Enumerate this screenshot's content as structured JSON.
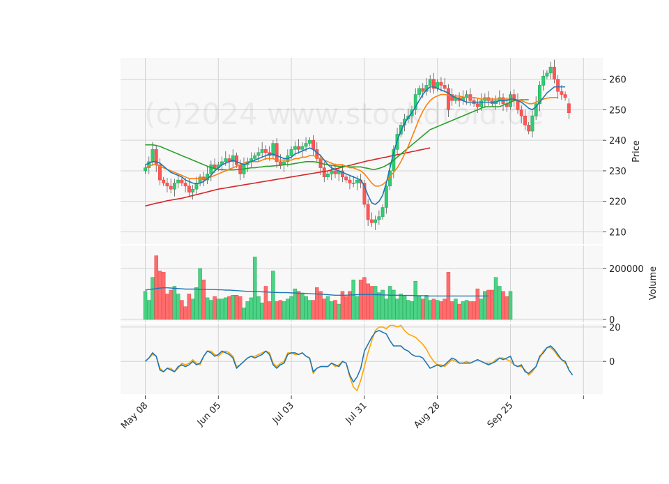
{
  "watermark": "(c)2024 www.stockdroid.de",
  "colors": {
    "panel_bg": "#f8f8f8",
    "grid": "#d3d3d3",
    "up": "#26a65b",
    "up_fill": "#2ecc71",
    "down": "#ee4444",
    "down_fill": "#ff5555",
    "ma_fast": "#1f77b4",
    "ma_mid": "#ff7f0e",
    "ma_slow": "#2ca02c",
    "ma_long": "#d62728",
    "vol_ma": "#1f77b4",
    "osc_1": "#1f77b4",
    "osc_2": "#ffa500",
    "axis_text": "#222222"
  },
  "chart_data": [
    {
      "type": "candlestick",
      "panel": "price",
      "ylabel": "Price",
      "ylim": [
        206,
        267
      ],
      "yticks": [
        210,
        220,
        230,
        240,
        250,
        260
      ],
      "x_ticks": [
        {
          "label": "May 08",
          "index": 0
        },
        {
          "label": "Jun 05",
          "index": 20
        },
        {
          "label": "Jul 03",
          "index": 40
        },
        {
          "label": "Jul 31",
          "index": 60
        },
        {
          "label": "Aug 28",
          "index": 80
        },
        {
          "label": "Sep 25",
          "index": 100
        },
        {
          "label": "",
          "index": 120
        }
      ],
      "close": [
        231,
        233,
        237,
        232,
        227,
        226,
        225,
        224,
        226,
        227,
        226,
        225,
        223,
        224,
        226,
        228,
        227,
        229,
        232,
        231,
        232,
        233,
        234,
        233,
        235,
        232,
        229,
        232,
        233,
        234,
        235,
        236,
        237,
        236,
        235,
        239,
        233,
        232,
        233,
        235,
        237,
        238,
        237,
        238,
        239,
        240,
        237,
        234,
        231,
        228,
        229,
        230,
        229,
        230,
        228,
        227,
        226,
        226,
        227,
        226,
        219,
        214,
        213,
        214,
        215,
        218,
        225,
        230,
        237,
        242,
        245,
        247,
        248,
        250,
        255,
        257,
        256,
        258,
        260,
        257,
        259,
        258,
        257,
        250,
        253,
        254,
        253,
        254,
        255,
        253,
        252,
        251,
        253,
        254,
        253,
        252,
        253,
        254,
        252,
        251,
        255,
        253,
        250,
        248,
        245,
        243,
        248,
        252,
        258,
        261,
        262,
        264,
        260,
        256,
        255,
        254,
        249
      ],
      "open": [
        230,
        231,
        233,
        237,
        232,
        227,
        226,
        225,
        224,
        226,
        227,
        226,
        225,
        223,
        224,
        226,
        228,
        227,
        229,
        232,
        231,
        232,
        233,
        234,
        233,
        235,
        232,
        229,
        232,
        233,
        234,
        235,
        236,
        237,
        236,
        235,
        239,
        233,
        232,
        233,
        235,
        237,
        238,
        237,
        238,
        239,
        240,
        237,
        234,
        231,
        228,
        229,
        230,
        229,
        230,
        228,
        227,
        226,
        226,
        227,
        226,
        219,
        214,
        213,
        214,
        215,
        218,
        225,
        230,
        237,
        242,
        245,
        247,
        248,
        250,
        255,
        257,
        256,
        258,
        260,
        257,
        259,
        258,
        257,
        255,
        253,
        254,
        253,
        254,
        255,
        253,
        252,
        251,
        253,
        254,
        253,
        252,
        253,
        254,
        252,
        251,
        255,
        253,
        250,
        248,
        245,
        243,
        248,
        252,
        258,
        261,
        262,
        264,
        260,
        256,
        255,
        252
      ],
      "ma_fast": [
        232,
        232.5,
        233,
        233,
        232.5,
        231.5,
        230.5,
        229.5,
        229,
        228.5,
        228,
        227,
        226.5,
        226,
        225.8,
        226,
        226.5,
        227.5,
        228.5,
        230,
        231,
        232,
        232.5,
        233,
        233.5,
        233,
        232.5,
        232,
        232.5,
        233,
        233.5,
        234,
        234.5,
        235,
        235.5,
        235.5,
        235,
        234.5,
        234,
        234,
        234.5,
        235.5,
        236,
        236.5,
        237,
        237.5,
        237,
        236,
        235,
        233.5,
        232,
        231,
        230.5,
        230,
        229.5,
        229,
        228.5,
        228,
        227.5,
        227,
        225,
        222,
        219.5,
        219,
        220,
        222,
        226,
        231,
        236,
        240,
        243,
        245.5,
        247.5,
        249,
        251,
        253,
        255,
        256.5,
        257.5,
        257.5,
        257,
        256.5,
        256,
        255.5,
        254.5,
        254,
        253.5,
        253,
        252.5,
        252.5,
        252.5,
        252.5,
        252.5,
        252.5,
        252.5,
        252.5,
        252.5,
        253,
        253,
        253,
        253.5,
        253.5,
        253,
        252.5,
        251.5,
        250.5,
        250,
        251,
        252.5,
        254,
        255.5,
        256.5,
        257.5,
        257.5,
        257.5,
        257.5
      ],
      "ma_mid": [
        231,
        231.5,
        232,
        232,
        231.5,
        231,
        230.5,
        230,
        229.5,
        229,
        228.5,
        228,
        227.5,
        227.5,
        227.5,
        227.5,
        227.5,
        227.7,
        228,
        228.5,
        229,
        229.5,
        230,
        230.5,
        231,
        231.5,
        232,
        232.5,
        233,
        233,
        233,
        233,
        233.5,
        234,
        234,
        234,
        233.5,
        233.5,
        233.5,
        233.5,
        233.5,
        234,
        234,
        234.5,
        234.5,
        235,
        235,
        234.5,
        234,
        233.5,
        233,
        232.5,
        232,
        232,
        232,
        231.5,
        231,
        231,
        230.5,
        230,
        229,
        227.5,
        226,
        225,
        225,
        225.5,
        226.5,
        228,
        229.5,
        231,
        233,
        235.5,
        238,
        241,
        244,
        247,
        249.5,
        251.5,
        253,
        254,
        254.5,
        255,
        255,
        254.8,
        254.5,
        254.5,
        254.5,
        254.2,
        254,
        254,
        254,
        253.8,
        253.5,
        253.5,
        253.5,
        253.5,
        253.5,
        253.5,
        253.5,
        253.5,
        253.5,
        253.5,
        253.3,
        253,
        252.5,
        252,
        252,
        252.5,
        253,
        253.5,
        253.8,
        254,
        254,
        254
      ],
      "ma_slow": [
        238.5,
        238.5,
        238.5,
        238.3,
        238,
        237.5,
        237,
        236.5,
        236,
        235.5,
        235,
        234.5,
        234,
        233.5,
        233,
        232.5,
        232,
        231.5,
        231,
        230.8,
        230.5,
        230.4,
        230.3,
        230.3,
        230.3,
        230.4,
        230.5,
        230.6,
        230.8,
        231,
        231,
        231.2,
        231.3,
        231.5,
        231.5,
        231.6,
        231.7,
        231.8,
        232,
        232,
        232.2,
        232.4,
        232.6,
        232.8,
        233,
        233,
        233,
        232.8,
        232.5,
        232.2,
        232,
        231.8,
        231.6,
        231.5,
        231.5,
        231.4,
        231.3,
        231.3,
        231.3,
        231.3,
        231,
        230.8,
        230.5,
        230.5,
        230.8,
        231.2,
        231.8,
        232.5,
        233.5,
        234.5,
        235.5,
        236.5,
        237.5,
        238.5,
        239.5,
        240.5,
        241.5,
        242.5,
        243.5,
        244,
        244.5,
        245,
        245.5,
        246,
        246.5,
        247,
        247.5,
        248,
        248.5,
        249,
        249.5,
        250,
        250.5,
        251,
        251,
        251,
        251,
        251,
        251.5,
        252,
        252.5,
        253,
        253.2,
        253.3,
        253.3,
        253.3
      ],
      "ma_long": [
        218.5,
        218.8,
        219.1,
        219.4,
        219.6,
        219.9,
        220.2,
        220.4,
        220.6,
        220.8,
        221,
        221.3,
        221.6,
        221.9,
        222.2,
        222.5,
        222.8,
        223.1,
        223.4,
        223.7,
        224,
        224.2,
        224.4,
        224.6,
        224.8,
        225,
        225.2,
        225.4,
        225.6,
        225.8,
        226,
        226.2,
        226.4,
        226.6,
        226.8,
        227,
        227.2,
        227.4,
        227.6,
        227.8,
        228,
        228.2,
        228.4,
        228.6,
        228.8,
        229,
        229.2,
        229.4,
        229.6,
        229.8,
        230,
        230.3,
        230.6,
        230.9,
        231.2,
        231.5,
        231.8,
        232.1,
        232.4,
        232.7,
        233,
        233.3,
        233.5,
        233.8,
        234,
        234.3,
        234.5,
        234.8,
        235,
        235.3,
        235.5,
        235.8,
        236,
        236.3,
        236.5,
        236.8,
        237,
        237.3,
        237.5
      ]
    },
    {
      "type": "bar",
      "panel": "volume",
      "ylabel": "Volume",
      "ylim": [
        0,
        290000
      ],
      "yticks": [
        0,
        200000
      ],
      "ytick_labels": [
        "0",
        "200000"
      ],
      "values": [
        110000,
        75000,
        165000,
        250000,
        190000,
        185000,
        100000,
        115000,
        130000,
        100000,
        75000,
        50000,
        100000,
        80000,
        125000,
        200000,
        155000,
        85000,
        75000,
        90000,
        80000,
        80000,
        85000,
        90000,
        95000,
        95000,
        90000,
        45000,
        70000,
        85000,
        245000,
        90000,
        65000,
        130000,
        70000,
        190000,
        70000,
        75000,
        70000,
        80000,
        90000,
        120000,
        110000,
        100000,
        90000,
        75000,
        75000,
        125000,
        110000,
        80000,
        90000,
        70000,
        75000,
        60000,
        110000,
        90000,
        110000,
        155000,
        90000,
        155000,
        165000,
        140000,
        130000,
        130000,
        105000,
        115000,
        80000,
        130000,
        115000,
        80000,
        100000,
        95000,
        75000,
        70000,
        150000,
        90000,
        80000,
        95000,
        75000,
        80000,
        75000,
        70000,
        80000,
        185000,
        70000,
        80000,
        60000,
        70000,
        75000,
        70000,
        70000,
        120000,
        80000,
        110000,
        115000,
        115000,
        165000,
        130000,
        110000,
        90000,
        110000
      ],
      "ma": [
        115000,
        117000,
        119000,
        121000,
        123000,
        124000,
        124000,
        123000,
        122000,
        121000,
        120000,
        119000,
        119000,
        119000,
        119000,
        118000,
        118000,
        118000,
        117000,
        117000,
        116000,
        116000,
        115000,
        115000,
        114000,
        113000,
        112000,
        111000,
        110000,
        110000,
        109000,
        109000,
        108000,
        108000,
        107000,
        106000,
        106000,
        105000,
        105000,
        105000,
        104000,
        104000,
        103000,
        103000,
        102000,
        101000,
        100000,
        100000,
        99000,
        98000,
        97000,
        96000,
        95000,
        95000,
        95000,
        95000,
        96000,
        96000,
        97000,
        98000,
        98000,
        98000,
        98000,
        97000,
        97000,
        96000,
        96000,
        95000,
        95000,
        95000,
        94000,
        94000,
        94000,
        94000,
        93000,
        93000,
        93000,
        92000,
        92000,
        92000,
        92000,
        92000,
        92000,
        92000,
        92000,
        92000,
        92000,
        92000,
        92000,
        92000,
        92000,
        92000,
        92000,
        92000,
        92000
      ]
    },
    {
      "type": "line",
      "panel": "oscillator",
      "ylim": [
        -19,
        22
      ],
      "yticks": [
        0,
        20
      ],
      "series": [
        {
          "values": [
            0,
            2,
            5,
            3,
            -5,
            -6,
            -4,
            -5,
            -6,
            -3,
            -2,
            -3,
            -2,
            0,
            -2,
            -1,
            3,
            6,
            5,
            3,
            4,
            6,
            5,
            4,
            2,
            -4,
            -2,
            0,
            2,
            3,
            2,
            3,
            4,
            6,
            4,
            -2,
            -4,
            -2,
            -1,
            4,
            5,
            5,
            4,
            5,
            3,
            2,
            -6,
            -4,
            -3,
            -3,
            -3,
            -1,
            -2,
            -3,
            0,
            -1,
            -8,
            -12,
            -9,
            -4,
            6,
            10,
            14,
            17,
            18,
            17,
            16,
            12,
            9,
            9,
            9,
            7,
            6,
            4,
            3,
            3,
            2,
            -1,
            -4,
            -3,
            -2,
            -3,
            -2,
            0,
            2,
            1,
            -1,
            -1,
            -1,
            -1,
            0,
            1,
            0,
            -1,
            -2,
            -1,
            0,
            2,
            1,
            2,
            3,
            -2,
            -3,
            -2,
            -6,
            -7,
            -5,
            -3,
            3,
            5,
            8,
            9,
            7,
            4,
            1,
            0,
            -5,
            -8
          ]
        },
        {
          "values": [
            0,
            2,
            4,
            3,
            -4,
            -6,
            -4,
            -4,
            -6,
            -4,
            -1,
            -2,
            -1,
            1,
            -1,
            -2,
            3,
            6,
            6,
            4,
            3,
            5,
            6,
            5,
            3,
            -3,
            -2,
            0,
            2,
            3,
            3,
            4,
            5,
            6,
            5,
            -1,
            -3,
            -1,
            0,
            5,
            5,
            4,
            4,
            5,
            3,
            2,
            -7,
            -4,
            -3,
            -3,
            -3,
            -1,
            -3,
            -2,
            0,
            -1,
            -9,
            -15,
            -17,
            -11,
            -3,
            5,
            12,
            18,
            20,
            20,
            19,
            21,
            21,
            20,
            21,
            18,
            16,
            15,
            14,
            12,
            10,
            7,
            3,
            0,
            -2,
            -2,
            -3,
            -1,
            1,
            0,
            -1,
            -1,
            0,
            -1,
            0,
            1,
            0,
            -1,
            -1,
            -1,
            1,
            2,
            2,
            1,
            0,
            -2,
            -3,
            -3,
            -5,
            -8,
            -6,
            -3,
            2,
            6,
            8,
            8,
            6,
            3,
            1,
            -1,
            -4
          ]
        }
      ]
    }
  ]
}
